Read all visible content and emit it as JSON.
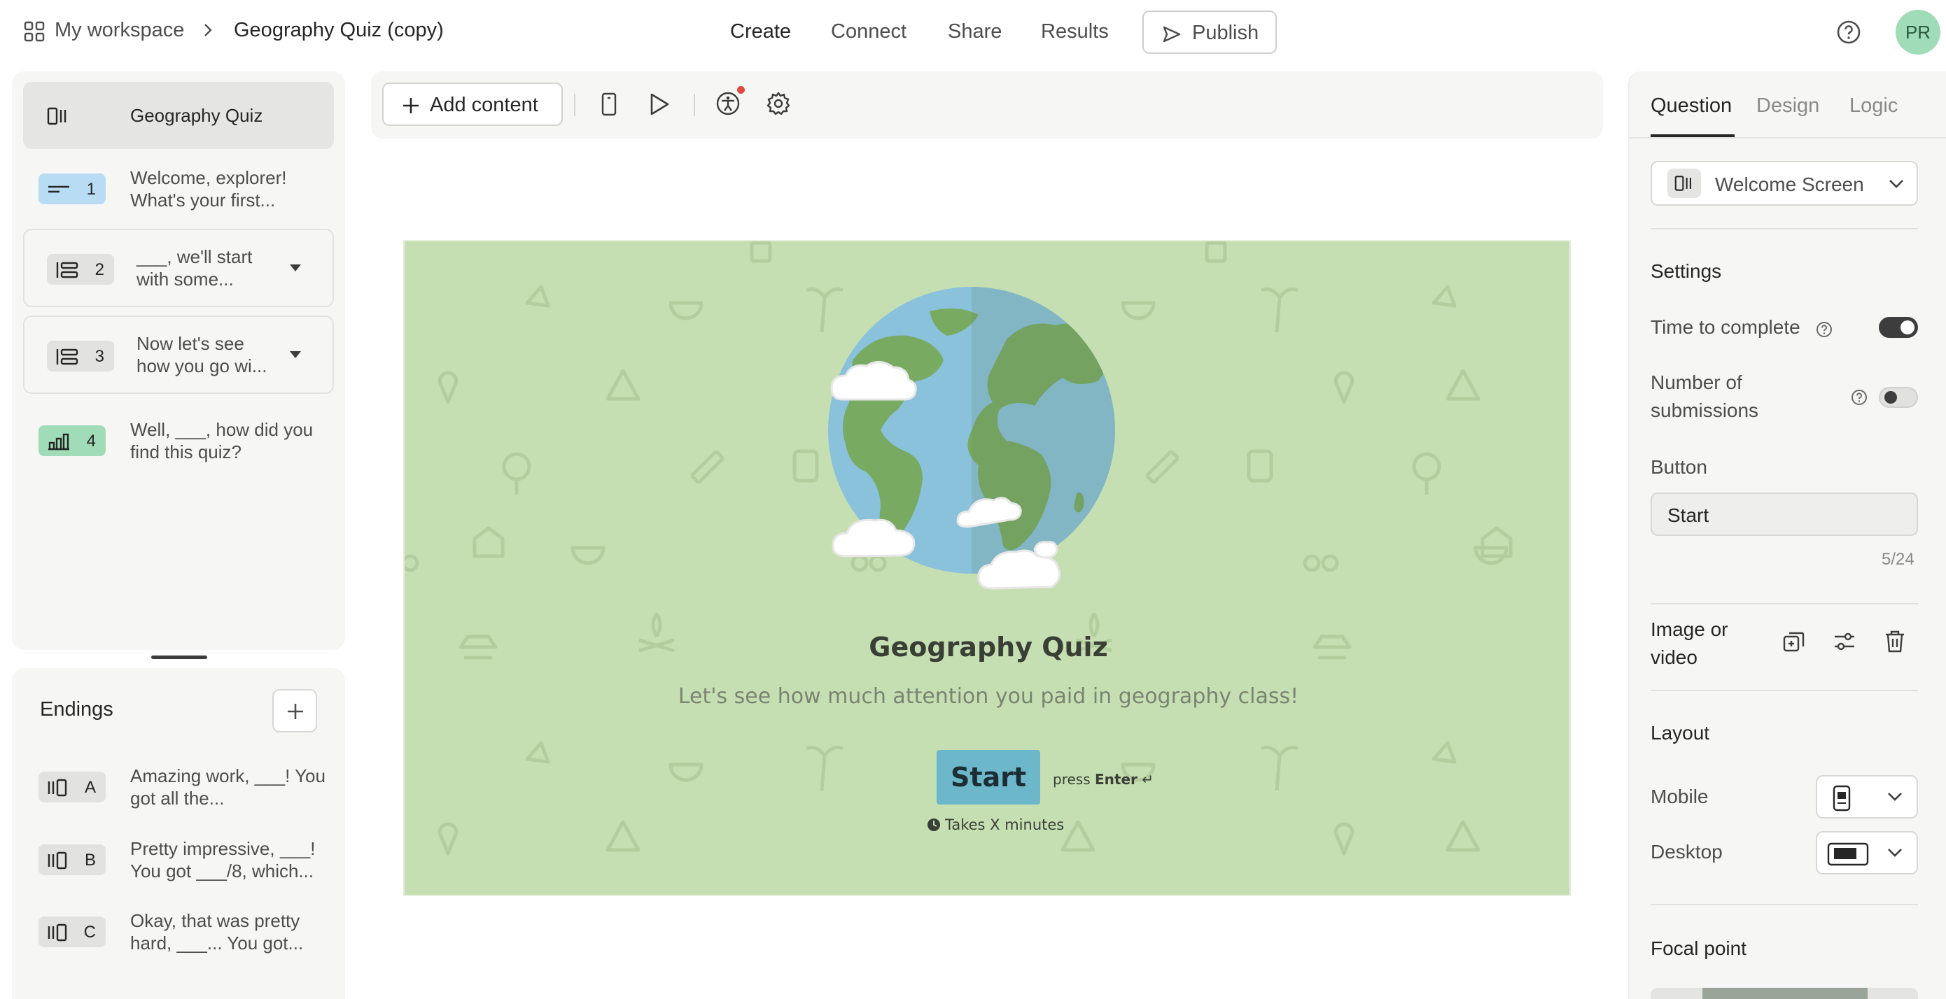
{
  "header": {
    "workspace": "My workspace",
    "form_title": "Geography Quiz (copy)",
    "nav": [
      "Create",
      "Connect",
      "Share",
      "Results"
    ],
    "publish": "Publish",
    "avatar_initials": "PR"
  },
  "sidebar": {
    "items": [
      {
        "number": "",
        "text": "Geography Quiz",
        "badge_color": "#e5e5e4"
      },
      {
        "number": "1",
        "text": "Welcome, explorer! What's your first...",
        "badge_color": "#b9dcf5"
      },
      {
        "number": "2",
        "text": "___, we'll start with some...",
        "badge_color": "#e2e2e1"
      },
      {
        "number": "3",
        "text": "Now let's see how you go wi...",
        "badge_color": "#e2e2e1"
      },
      {
        "number": "4",
        "text": "Well, ___, how did you find this quiz?",
        "badge_color": "#9fdcb7"
      }
    ],
    "endings_title": "Endings",
    "endings": [
      {
        "letter": "A",
        "text": "Amazing work, ___! You got all the..."
      },
      {
        "letter": "B",
        "text": "Pretty impressive, ___! You got ___/8, which..."
      },
      {
        "letter": "C",
        "text": "Okay, that was pretty hard, ___... You got..."
      }
    ]
  },
  "toolbar": {
    "add_content": "Add content"
  },
  "canvas": {
    "title": "Geography Quiz",
    "subtitle": "Let's see how much attention you paid in geography class!",
    "start_button": "Start",
    "press": "press",
    "enter": "Enter",
    "enter_symbol": "↵",
    "takes": "Takes X minutes",
    "bg_color": "#c6dfb2",
    "button_color": "#6cb7c9"
  },
  "right_panel": {
    "tabs": [
      "Question",
      "Design",
      "Logic"
    ],
    "block_type": "Welcome Screen",
    "settings_title": "Settings",
    "time_to_complete": "Time to complete",
    "number_of_submissions_1": "Number of",
    "number_of_submissions_2": "submissions",
    "button_label": "Button",
    "button_value": "Start",
    "button_counter": "5/24",
    "image_or_video_1": "Image or",
    "image_or_video_2": "video",
    "layout_title": "Layout",
    "mobile": "Mobile",
    "desktop": "Desktop",
    "focal_point": "Focal point"
  }
}
